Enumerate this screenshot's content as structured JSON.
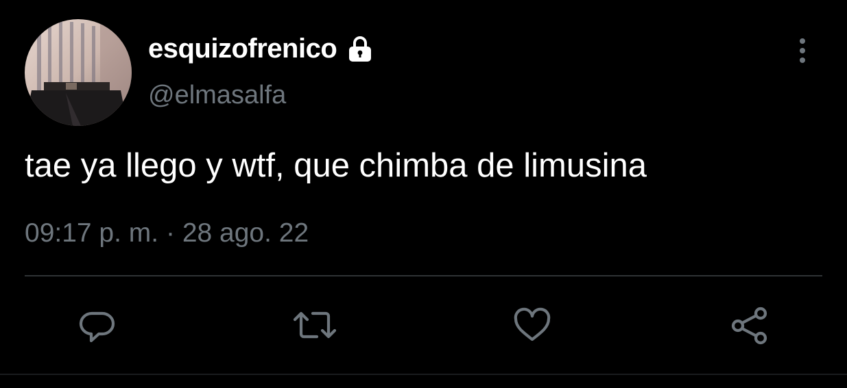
{
  "user": {
    "display_name": "esquizofrenico",
    "handle": "@elmasalfa",
    "protected": true,
    "verified_icon": "lock-icon"
  },
  "tweet": {
    "text": "tae ya llego y wtf, que chimba de limusina",
    "time": "09:17 p. m.",
    "separator": "·",
    "date": "28 ago. 22"
  },
  "actions": [
    {
      "name": "reply",
      "icon": "reply-icon"
    },
    {
      "name": "retweet",
      "icon": "retweet-icon"
    },
    {
      "name": "like",
      "icon": "heart-icon"
    },
    {
      "name": "share",
      "icon": "share-icon"
    }
  ],
  "colors": {
    "background": "#000000",
    "text": "#ffffff",
    "secondary": "#6e767d",
    "divider": "#2f3336"
  }
}
